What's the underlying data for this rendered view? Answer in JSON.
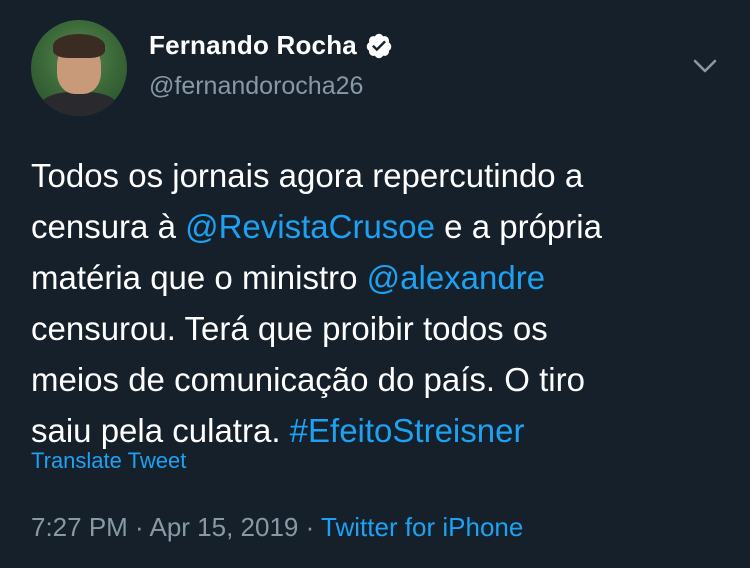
{
  "user": {
    "display_name": "Fernando Rocha",
    "handle": "@fernandorocha26",
    "verified_icon": "verified-badge-icon"
  },
  "tweet": {
    "segments": [
      {
        "text": "Todos os jornais agora repercutindo a",
        "type": "text"
      },
      {
        "text": "censura à ",
        "type": "text"
      },
      {
        "text": "@RevistaCrusoe",
        "type": "mention"
      },
      {
        "text": " e a própria",
        "type": "text"
      },
      {
        "text": "matéria que o ministro ",
        "type": "text"
      },
      {
        "text": "@alexandre",
        "type": "mention"
      },
      {
        "text": "censurou. Terá que proibir todos os",
        "type": "text"
      },
      {
        "text": "meios de comunicação do país. O tiro",
        "type": "text"
      },
      {
        "text": "saiu pela culatra. ",
        "type": "text"
      },
      {
        "text": "#EfeitoStreisner",
        "type": "hashtag"
      }
    ],
    "translate_label": "Translate Tweet",
    "time": "7:27 PM",
    "separator": " · ",
    "date": "Apr 15, 2019",
    "source": "Twitter for iPhone"
  },
  "colors": {
    "background": "#15202b",
    "text": "#ffffff",
    "secondary": "#8899a6",
    "link": "#1da1f2"
  },
  "icons": {
    "menu": "chevron-down-icon"
  }
}
